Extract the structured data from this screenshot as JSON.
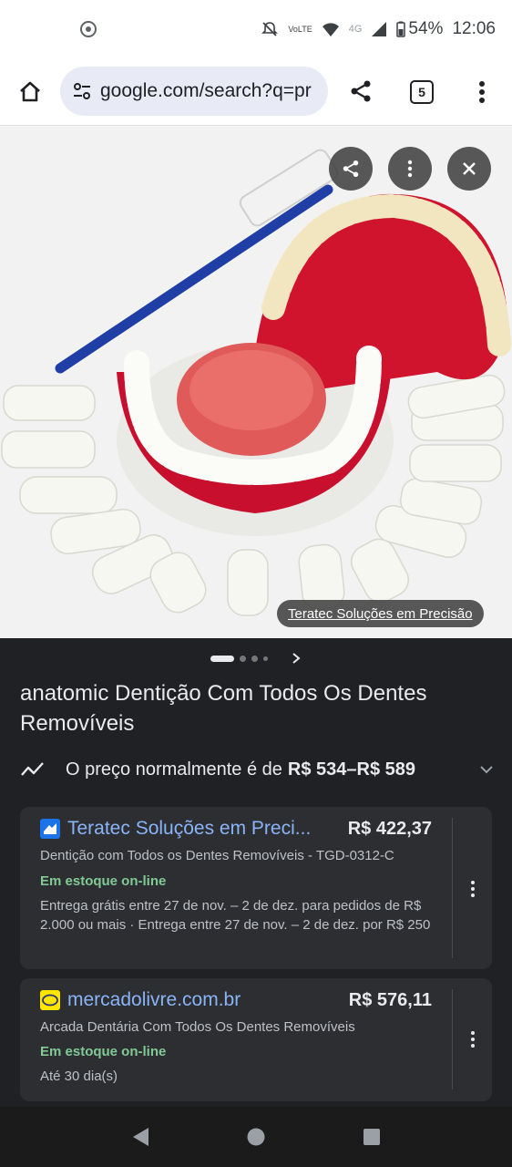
{
  "status_bar": {
    "battery": "54%",
    "time": "12:06",
    "network": "4G",
    "volte": "VoLTE"
  },
  "browser": {
    "url": "google.com/search?q=pr",
    "tab_count": "5"
  },
  "image_viewer": {
    "source_label": "Teratec Soluções em Precisão",
    "image_subject": "dental model with removable teeth and toothbrush"
  },
  "product": {
    "title": "anatomic Dentição Com Todos Os Dentes Removíveis",
    "price_prefix": "O preço normalmente é de",
    "price_range": "R$ 534–R$ 589"
  },
  "offers": [
    {
      "merchant": "Teratec Soluções em Preci...",
      "price": "R$ 422,37",
      "description": "Dentição com Todos os Dentes Removíveis - TGD-0312-C",
      "stock": "Em estoque on-line",
      "shipping": "Entrega grátis entre 27 de nov. – 2 de dez. para pedidos de R$ 2.000 ou mais · Entrega entre 27 de nov. – 2 de dez. por R$ 250"
    },
    {
      "merchant": "mercadolivre.com.br",
      "price": "R$ 576,11",
      "description": "Arcada Dentária Com Todos Os Dentes Removíveis",
      "stock": "Em estoque on-line",
      "shipping": "Até 30 dia(s)"
    }
  ],
  "colors": {
    "link": "#8ab4f8",
    "stock": "#81c995",
    "background": "#202124",
    "card": "#2d2e31"
  }
}
